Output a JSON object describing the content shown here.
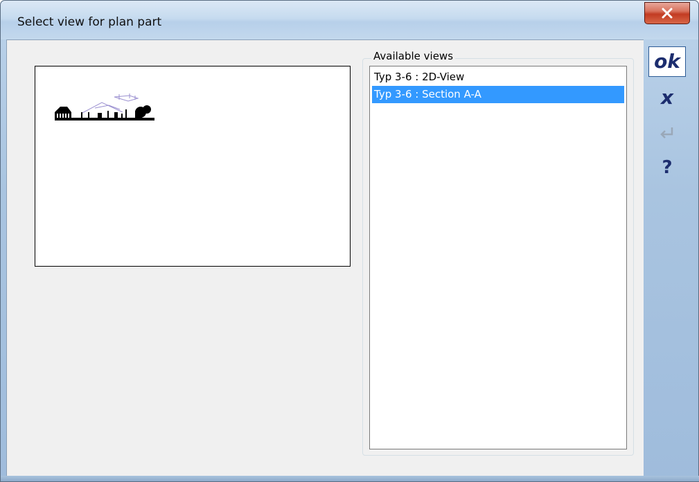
{
  "window": {
    "title": "Select view for plan part"
  },
  "views_group": {
    "label": "Available views",
    "items": [
      {
        "label": "Typ 3-6 : 2D-View",
        "selected": false
      },
      {
        "label": "Typ 3-6 : Section A-A",
        "selected": true
      }
    ]
  },
  "toolbar": {
    "ok_label": "ok",
    "cancel_label": "x",
    "help_label": "?",
    "enter_icon": "enter-return-icon"
  },
  "icons": {
    "close": "close-icon",
    "preview": "house-elevation-thumbnail"
  },
  "colors": {
    "selection": "#3399ff",
    "button_text": "#1c2d6e",
    "close_button": "#c23b22"
  }
}
